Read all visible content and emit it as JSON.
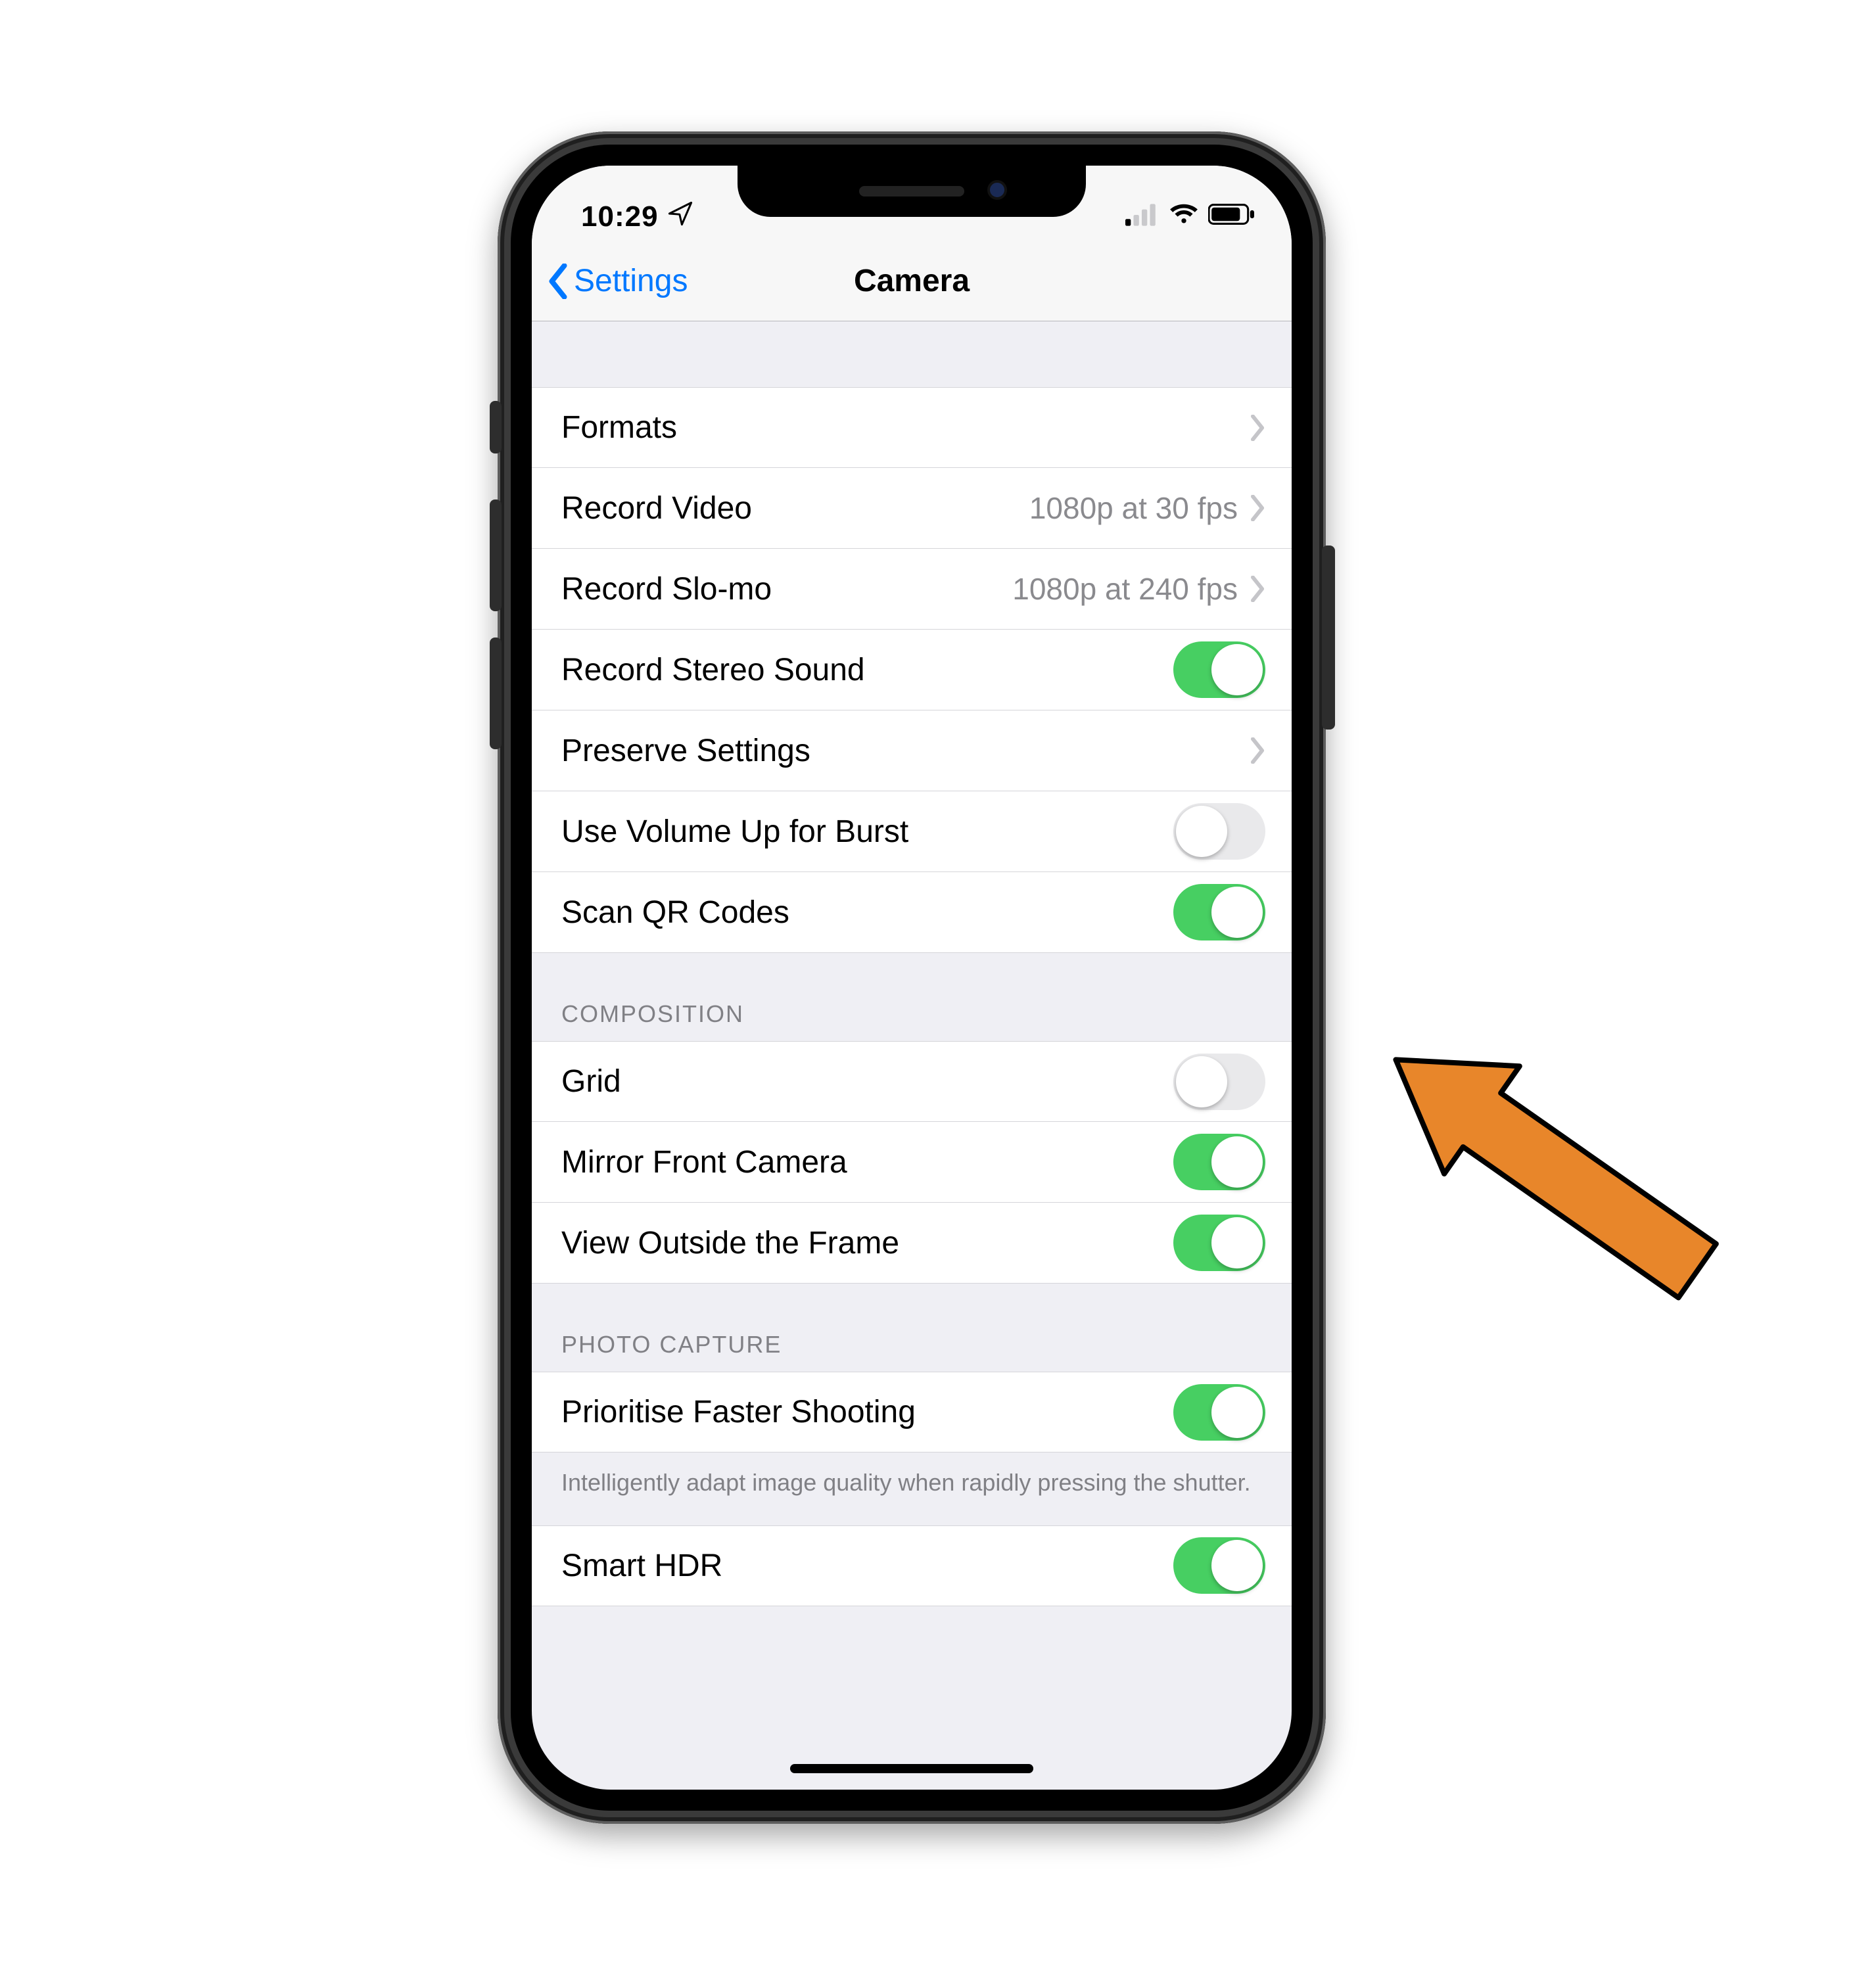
{
  "status": {
    "time": "10:29",
    "location_icon": "location-arrow"
  },
  "nav": {
    "back": "Settings",
    "title": "Camera"
  },
  "section1": {
    "formats": {
      "label": "Formats"
    },
    "recordVideo": {
      "label": "Record Video",
      "value": "1080p at 30 fps"
    },
    "recordSlomo": {
      "label": "Record Slo-mo",
      "value": "1080p at 240 fps"
    },
    "stereoSound": {
      "label": "Record Stereo Sound",
      "on": true
    },
    "preserve": {
      "label": "Preserve Settings"
    },
    "volBurst": {
      "label": "Use Volume Up for Burst",
      "on": false
    },
    "qr": {
      "label": "Scan QR Codes",
      "on": true
    }
  },
  "composition": {
    "header": "COMPOSITION",
    "grid": {
      "label": "Grid",
      "on": false
    },
    "mirror": {
      "label": "Mirror Front Camera",
      "on": true
    },
    "outside": {
      "label": "View Outside the Frame",
      "on": true
    }
  },
  "photoCapture": {
    "header": "PHOTO CAPTURE",
    "faster": {
      "label": "Prioritise Faster Shooting",
      "on": true
    },
    "footer": "Intelligently adapt image quality when rapidly pressing the shutter.",
    "smartHDR": {
      "label": "Smart HDR",
      "on": true
    }
  },
  "annotation": {
    "target": "mirror-front-camera-toggle"
  },
  "colors": {
    "toggleOn": "#47cf62",
    "accent": "#0078ff",
    "arrow": "#e8862a"
  }
}
